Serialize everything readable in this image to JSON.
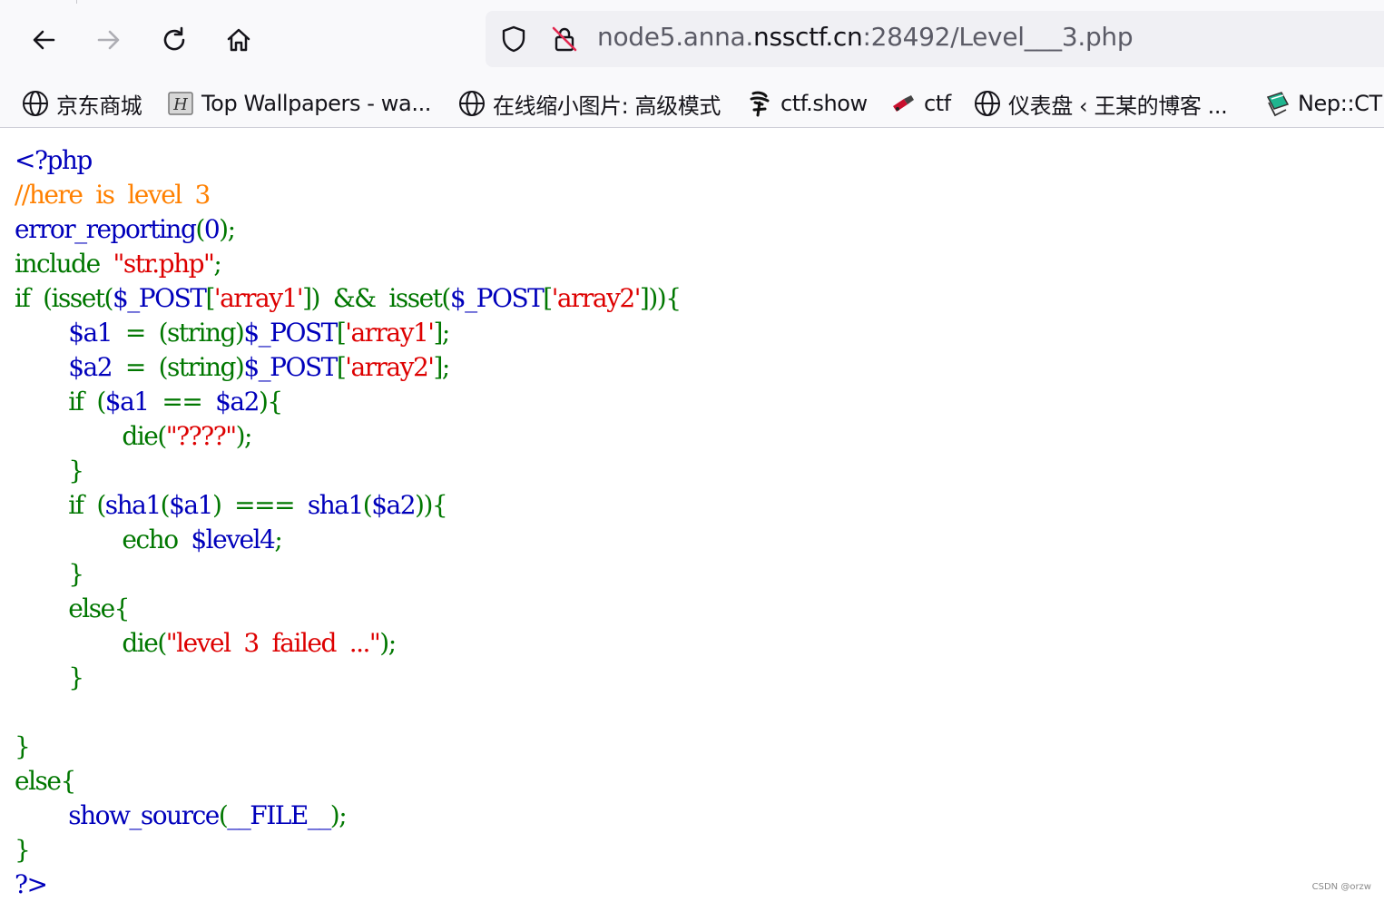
{
  "url": {
    "prefix": "node5.anna.",
    "domain": "nssctf.cn",
    "suffix": ":28492/Level___3.php"
  },
  "bookmarks": [
    {
      "label": "京东商城",
      "icon": "globe-icon"
    },
    {
      "label": "Top Wallpapers - wa...",
      "icon": "wallpaper-favicon-icon"
    },
    {
      "label": "在线缩小图片: 高级模式",
      "icon": "globe-icon"
    },
    {
      "label": "ctf.show",
      "icon": "ctfshow-favicon-icon"
    },
    {
      "label": "ctf",
      "icon": "ctf-favicon-icon"
    },
    {
      "label": "仪表盘 ‹ 王某的博客 ...",
      "icon": "globe-icon"
    },
    {
      "label": "Nep::CTF",
      "icon": "nep-favicon-icon"
    }
  ],
  "code": {
    "l1": "<?php",
    "l2": "//here  is  level  3",
    "l3a": "error_reporting",
    "l3b": "(",
    "l3c": "0",
    "l3d": ");",
    "l4a": "include  ",
    "l4b": "\"str.php\"",
    "l4c": ";",
    "l5a": "if  (isset(",
    "l5b": "$_POST",
    "l5c": "[",
    "l5d": "'array1'",
    "l5e": "])  &&  isset(",
    "l5f": "$_POST",
    "l5g": "[",
    "l5h": "'array2'",
    "l5i": "])){",
    "l6a": "        ",
    "l6b": "$a1  ",
    "l6c": "=  (string)",
    "l6d": "$_POST",
    "l6e": "[",
    "l6f": "'array1'",
    "l6g": "];",
    "l7a": "        ",
    "l7b": "$a2  ",
    "l7c": "=  (string)",
    "l7d": "$_POST",
    "l7e": "[",
    "l7f": "'array2'",
    "l7g": "];",
    "l8a": "        if  (",
    "l8b": "$a1  ",
    "l8c": "==  ",
    "l8d": "$a2",
    "l8e": "){",
    "l9a": "                die(",
    "l9b": "\"????\"",
    "l9c": ");",
    "l10": "        }",
    "l11a": "        if  (",
    "l11b": "sha1",
    "l11c": "(",
    "l11d": "$a1",
    "l11e": ")  ===  ",
    "l11f": "sha1",
    "l11g": "(",
    "l11h": "$a2",
    "l11i": ")){",
    "l12a": "                echo  ",
    "l12b": "$level4",
    "l12c": ";",
    "l13": "        }",
    "l14": "        else{",
    "l15a": "                die(",
    "l15b": "\"level  3  failed  ...\"",
    "l15c": ");",
    "l16": "        }",
    "l17": "",
    "l18": "}",
    "l19": "else{",
    "l20a": "        ",
    "l20b": "show_source",
    "l20c": "(",
    "l20d": "__FILE__",
    "l20e": ");",
    "l21": "}",
    "l22": "?>"
  },
  "watermark": "CSDN @orzw",
  "colors": {
    "keyword": "#007700",
    "string": "#dd0000",
    "comment": "#ff8000",
    "default": "#0000bb"
  }
}
